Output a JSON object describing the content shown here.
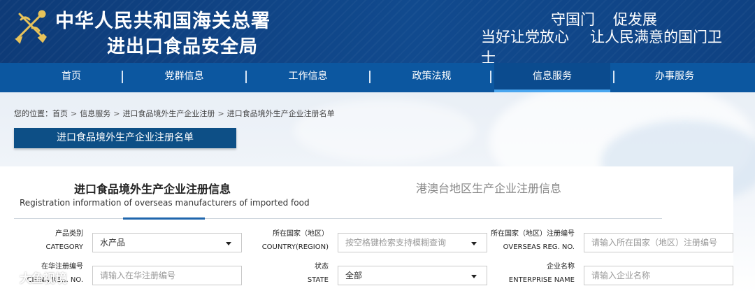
{
  "header": {
    "title_line1": "中华人民共和国海关总署",
    "title_line2": "进出口食品安全局",
    "slogan1": [
      "守国门",
      "促发展"
    ],
    "slogan2": [
      "当好让党放心",
      "让人民满意的国门卫士"
    ]
  },
  "nav": {
    "items": [
      "首页",
      "党群信息",
      "工作信息",
      "政策法规",
      "信息服务",
      "办事服务"
    ],
    "active_index": 4,
    "separator": "|"
  },
  "breadcrumb": {
    "label": "您的位置：",
    "items": [
      "首页",
      "信息服务",
      "进口食品境外生产企业注册",
      "进口食品境外生产企业注册名单"
    ],
    "separator": ">"
  },
  "banner": {
    "title": "进口食品境外生产企业注册名单"
  },
  "tabs": {
    "main_title": "进口食品境外生产企业注册信息",
    "main_subtitle": "Registration information of overseas manufacturers of imported food",
    "alt_title": "港澳台地区生产企业注册信息"
  },
  "filters": {
    "category": {
      "label_cn": "产品类别",
      "label_en": "CATEGORY",
      "value": "水产品"
    },
    "country": {
      "label_cn": "所在国家（地区）",
      "label_en": "COUNTRY(REGION)",
      "placeholder": "按空格键检索支持模糊查询"
    },
    "overseas_reg": {
      "label_cn": "所在国家（地区）注册编号",
      "label_en": "OVERSEAS REG. NO.",
      "placeholder": "请输入所在国家（地区）注册编号"
    },
    "china_reg": {
      "label_cn": "在华注册编号",
      "label_en": "CHINA REG. NO.",
      "placeholder": "请输入在华注册编号"
    },
    "state": {
      "label_cn": "状态",
      "label_en": "STATE",
      "value": "全部"
    },
    "enterprise": {
      "label_cn": "企业名称",
      "label_en": "ENTERPRISE NAME",
      "placeholder": "请输入企业名称"
    }
  },
  "watermark": {
    "text": "大鱼视境"
  },
  "colors": {
    "header_bg": "#0e3b78",
    "nav_bg": "#0c57a0",
    "nav_active_indicator": "#4aa6ef",
    "banner_bg": "#0d4f86",
    "tab_underline": "#1f66ad"
  }
}
